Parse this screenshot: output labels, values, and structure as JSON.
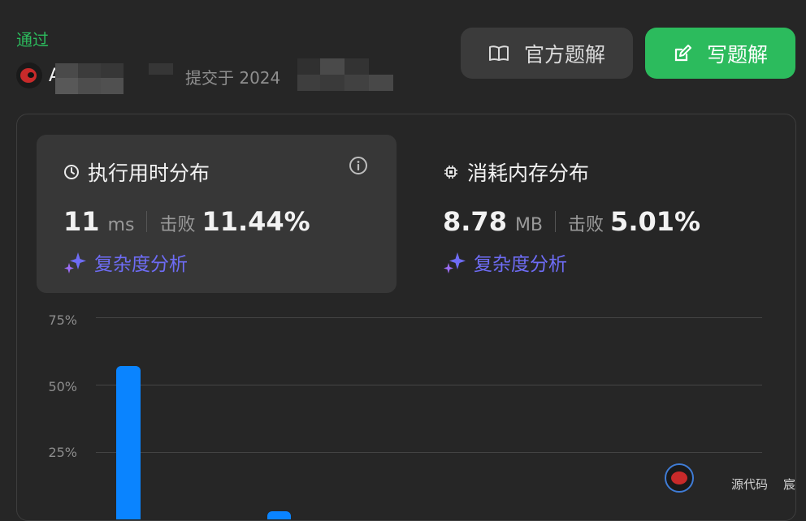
{
  "status": "通过",
  "user": {
    "name": "A",
    "submitted_prefix": "提交于 2024"
  },
  "buttons": {
    "official": "官方题解",
    "write": "写题解"
  },
  "runtime": {
    "title": "执行用时分布",
    "value": "11",
    "unit": "ms",
    "beat_label": "击败",
    "beat_value": "11.44%",
    "complexity": "复杂度分析"
  },
  "memory": {
    "title": "消耗内存分布",
    "value": "8.78",
    "unit": "MB",
    "beat_label": "击败",
    "beat_value": "5.01%",
    "complexity": "复杂度分析"
  },
  "chart_data": {
    "type": "bar",
    "ylim": [
      0,
      75
    ],
    "yticks": [
      "75%",
      "50%",
      "25%"
    ],
    "values": [
      57,
      3
    ],
    "grid": true
  },
  "footer": {
    "source_code": "源代码",
    "author": "宸"
  },
  "colors": {
    "accent_green": "#2cbb5d",
    "bar_blue": "#0a84ff",
    "complexity_purple": "#6e6cf5"
  }
}
